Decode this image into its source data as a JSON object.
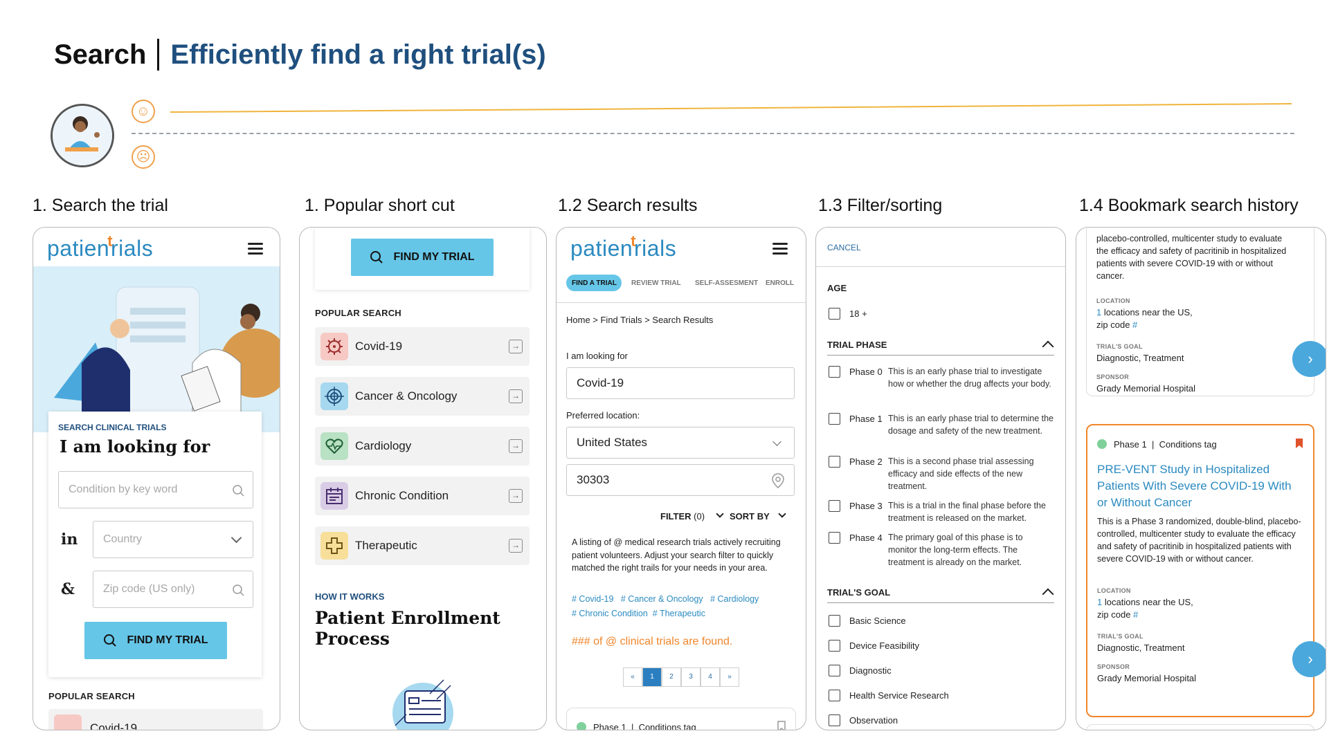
{
  "header": {
    "title": "Search",
    "subtitle": "Efficiently find a right trial(s)"
  },
  "colors": {
    "accent": "#66c6e7",
    "brand_blue": "#2b8ac0",
    "brand_orange": "#f0862b",
    "title_blue": "#1f4f7e",
    "bookmark": "#e0522b"
  },
  "columns": [
    {
      "title": "1. Search the trial"
    },
    {
      "title": "1. Popular short cut"
    },
    {
      "title": "1.2 Search results"
    },
    {
      "title": "1.3 Filter/sorting"
    },
    {
      "title": "1.4 Bookmark search history"
    }
  ],
  "logo": {
    "part1": "patien",
    "part2": "t",
    "part3": "rials"
  },
  "screen1": {
    "search_heading": "SEARCH CLINICAL TRIALS",
    "looking_for": "I am looking for",
    "condition_placeholder": "Condition by key word",
    "in_label": "in",
    "country_placeholder": "Country",
    "amp_label": "&",
    "zip_placeholder": "Zip code (US only)",
    "find_button": "FIND MY TRIAL",
    "popular_search": "POPULAR SEARCH",
    "peek_item": "Covid-19"
  },
  "screen2": {
    "find_button": "FIND MY TRIAL",
    "popular_search": "POPULAR SEARCH",
    "items": [
      {
        "label": "Covid-19",
        "icon": "virus-icon",
        "bg": "#f7c9c4"
      },
      {
        "label": "Cancer & Oncology",
        "icon": "target-icon",
        "bg": "#a6d9ef"
      },
      {
        "label": "Cardiology",
        "icon": "heart-icon",
        "bg": "#b9e1c3"
      },
      {
        "label": "Chronic Condition",
        "icon": "calendar-icon",
        "bg": "#d9cde6"
      },
      {
        "label": "Therapeutic",
        "icon": "plus-icon",
        "bg": "#f7df9a"
      }
    ],
    "how_it_works": "HOW IT WORKS",
    "process_title_1": "Patient Enrollment",
    "process_title_2": "Process"
  },
  "screen3": {
    "tabs": [
      "FIND A TRIAL",
      "REVIEW TRIAL",
      "SELF-ASSESMENT",
      "ENROLL"
    ],
    "breadcrumb": "Home > Find Trials > Search Results",
    "looking_label": "I am looking for",
    "looking_value": "Covid-19",
    "location_label": "Preferred location:",
    "country_value": "United States",
    "zip_value": "30303",
    "filter_label": "FILTER",
    "filter_count": "(0)",
    "sort_label": "SORT BY",
    "description": "A listing of @ medical research trials actively recruiting patient volunteers. Adjust your search filter to quickly matched the right trails for your needs in your area.",
    "tags_row1": [
      "# Covid-19",
      "# Cancer & Oncology",
      "# Cardiology"
    ],
    "tags_row2": [
      "# Chronic Condition",
      "# Therapeutic"
    ],
    "found_text": "### of @ clinical trials are found.",
    "pagination": [
      "«",
      "1",
      "2",
      "3",
      "4",
      "»"
    ],
    "peek_phase": "Phase 1",
    "peek_sep": "|",
    "peek_tag": "Conditions tag"
  },
  "screen4": {
    "cancel": "CANCEL",
    "age_head": "AGE",
    "age_option": "18 +",
    "phase_head": "TRIAL PHASE",
    "phases": [
      {
        "label": "Phase 0",
        "desc": "This is an early phase trial to investigate how or whether the drug affects your body."
      },
      {
        "label": "Phase 1",
        "desc": "This is an early phase trial to determine the dosage and safety of the new treatment."
      },
      {
        "label": "Phase 2",
        "desc": "This is a second phase trial assessing efficacy and side effects of the new treatment."
      },
      {
        "label": "Phase 3",
        "desc": "This is a trial in the final phase before the treatment is released on the market."
      },
      {
        "label": "Phase 4",
        "desc": "The primary goal of this phase is to monitor the long-term effects. The treatment is already on the market."
      }
    ],
    "goal_head": "TRIAL'S GOAL",
    "goals": [
      "Basic Science",
      "Device Feasibility",
      "Diagnostic",
      "Health Service Research",
      "Observation"
    ]
  },
  "screen5": {
    "top_desc_1": "placebo-controlled, multicenter study to evaluate",
    "top_desc_2": "the efficacy and safety of pacritinib in hospitalized",
    "top_desc_3": "patients with severe COVID-19 with or without",
    "top_desc_4": "cancer.",
    "location_label": "LOCATION",
    "locations_count": "1",
    "locations_text": "locations near the US,",
    "zip_text": "zip code",
    "zip_hash": "#",
    "goal_label": "TRIAL'S GOAL",
    "goal_value": "Diagnostic, Treatment",
    "sponsor_label": "SPONSOR",
    "sponsor_value": "Grady Memorial Hospital",
    "card_phase": "Phase 1",
    "card_sep": "|",
    "card_tag": "Conditions tag",
    "card_title": "PRE-VENT Study in Hospitalized Patients With Severe COVID-19 With or Without Cancer",
    "card_desc": "This is a Phase 3 randomized, double-blind, placebo-controlled, multicenter study to evaluate the efficacy and safety of pacritinib in hospitalized patients with severe COVID-19 with or without cancer."
  }
}
